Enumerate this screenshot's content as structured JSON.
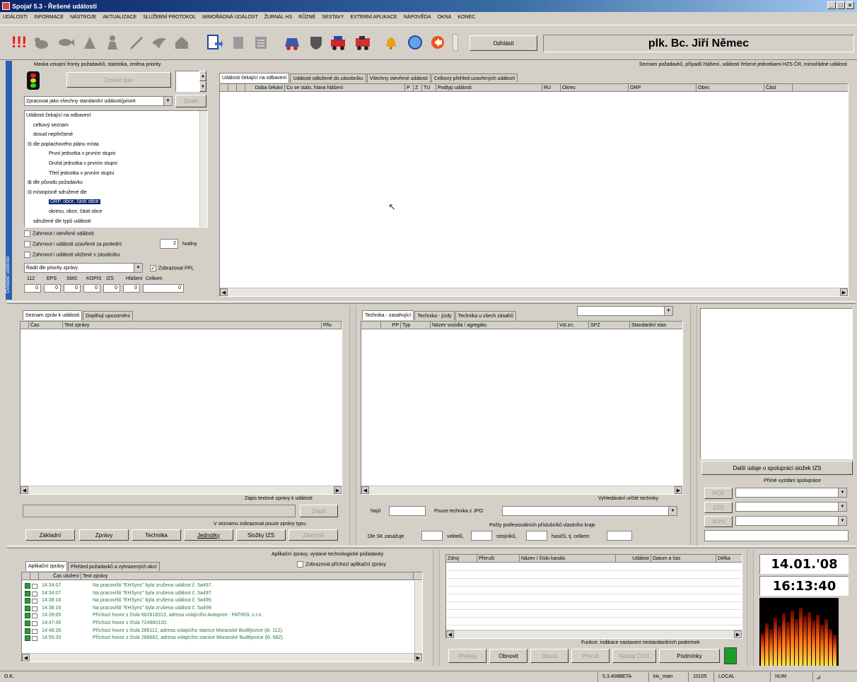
{
  "window": {
    "title": "Spojař 5.3 - Řešené události"
  },
  "menu": [
    "UDÁLOSTI",
    "INFORMACE",
    "NÁSTROJE",
    "AKTUALIZACE",
    "SLUŽEBNÍ PROTOKOL",
    "MIMOŘÁDNÁ UDÁLOST",
    "ŽURNÁL HS",
    "RŮZNÉ",
    "SESTAVY",
    "EXTERNÍ APLIKACE",
    "NÁPOVĚDA",
    "OKNA",
    "KONEC"
  ],
  "toolbar": {
    "odhlasit_label": "Odhlásit",
    "user_name": "plk. Bc. Jiří Němec"
  },
  "filter_panel": {
    "title": "Maska vstupní fronty požadavků, statistika, změna priority",
    "zmena_button": "Změnit stav",
    "mode_select": "Zpracovat jako všechny standardní události(priorit",
    "zmen_button": "Změň",
    "tree": [
      "Události čekající na odbavení",
      "celkový seznam",
      "dosud nepřečtené",
      "dle poplachového plánu místa",
      "První jednotka v prvním stupni",
      "Druhá jednotka v prvním stupni",
      "Třetí jednotka v prvním stupni",
      "dle původu požadavku",
      "místopisně sdružené dle",
      "ORP, obce, části obce",
      "okresu, obce, části obce",
      "sdružené dle typů událostí"
    ],
    "cb1": "Zahrnout i otevřené události",
    "cb2": "Zahrnout i události uzavřené za poslední",
    "hours_value": "2",
    "hours_label": "hodiny",
    "cb3": "Zahrnout i události uložené v zásobníku",
    "sort_select": "Řadit dle priority zprávy",
    "show_ppl": "Zobrazovat PPL",
    "counters": [
      {
        "label": "112",
        "value": "0"
      },
      {
        "label": "EPS",
        "value": "0"
      },
      {
        "label": "SMS",
        "value": "0"
      },
      {
        "label": "KOPIS",
        "value": "0"
      },
      {
        "label": "IZS",
        "value": "0"
      },
      {
        "label": "Hlášení",
        "value": "0"
      },
      {
        "label": "Celkem",
        "value": "0"
      }
    ],
    "side_label": "Ovladač událostí"
  },
  "events": {
    "caption": "Seznam požadavků, případů hlášení, událostí řešené jednotkami HZS ČR, mimořádné události",
    "tabs": [
      "Události čekající na odbavení",
      "Události odložené do zásobníku",
      "Všechny otevřené události",
      "Celkový přehled uzavřených událostí"
    ],
    "columns": [
      "Doba čekání",
      "Co se stalo, hlava hlášení",
      "P",
      "Z",
      "TU",
      "Podtyp události",
      "RU",
      "Okres",
      "ORP",
      "Obec",
      "Část"
    ]
  },
  "messages": {
    "tabs": [
      "Seznam zpráv k události",
      "Doplňují upozornění"
    ],
    "columns": [
      "Čas",
      "Text zprávy",
      "Přiv"
    ],
    "zapis_label": "Zápis textové zprávy k události",
    "zapis_button": "Zapiš",
    "filter_label": "V seznamu zobrazovat pouze zprávy typu:",
    "filter_buttons": [
      "Základní",
      "Zprávy",
      "Technika",
      "Jednotky",
      "Složky IZS",
      "Závorné"
    ]
  },
  "technika": {
    "tabs": [
      "Technika - zasahující",
      "Technika - jízdy",
      "Technika u všech zásahů"
    ],
    "columns": [
      "PP",
      "Typ",
      "Název vozidla / agregátu",
      "Vol.zn.",
      "SPZ",
      "Standardní stan"
    ],
    "search_label": "Vyhledávání určité techniky",
    "najit_label": "Najít",
    "pouze_label": "Pouze technika z JPO:",
    "pocty_label": "Počty profesionálních příslušníků vlastního kraje",
    "dle_label": "Dle SK zasažuje",
    "velitelu": "velitelů,",
    "strojniku": "strojníků,",
    "hasicu": "hasičů, tj. celkem"
  },
  "right_panel": {
    "dalsi_button": "Další údaje o spolupráci složek IZS",
    "prime_label": "Přímé vyzdání spolupráce",
    "combo_buttons": [
      "PČR",
      "ZZS",
      "JKPV"
    ]
  },
  "app_messages": {
    "caption": "Aplikační zprávy, vyslané technologické požadavky",
    "show_all": "Zobrazovat příchozí aplikační zprávy",
    "tabs": [
      "Aplikační zprávy",
      "Přehled požadavků a vyhrazených akcí"
    ],
    "columns": [
      "Čas uložení",
      "Text zprávy"
    ],
    "rows": [
      {
        "time": "14:34:07",
        "text": "Na pracovišti \"EHSync\" byla zrušena událost č. 5a497."
      },
      {
        "time": "14:34:07",
        "text": "Na pracovišti \"EHSync\" byla zrušena událost č. 5a497."
      },
      {
        "time": "14:38:16",
        "text": "Na pracovišti \"EHSync\" byla zrušena událost č. 5a499."
      },
      {
        "time": "14:38:16",
        "text": "Na pracovišti \"EHSync\" byla zrušena událost č. 5a499."
      },
      {
        "time": "14:39:05",
        "text": "Příchozí hovor z čísla 602818313, adresa volajícího Autoprint - PATROL s.r.o."
      },
      {
        "time": "14:47:45",
        "text": "Příchozí hovor z čísla 724980120."
      },
      {
        "time": "14:48:26",
        "text": "Příchozí hovor z čísla 286112, adresa volajícího stanice Moravské Budějovice (kl. 112)."
      },
      {
        "time": "14:55:33",
        "text": "Příchozí hovor z čísla 286682, adresa volajícího stanice Moravské Budějovice (kl. 682)."
      }
    ]
  },
  "radio": {
    "columns": [
      "Zdroj",
      "Přeruší",
      "Název / číslo kanálu",
      "Událost",
      "Datum a čas",
      "Délka"
    ],
    "funkce_label": "Funkce, indikace nastavení nestandardních podmínek",
    "buttons": [
      "Přehraj",
      "Obnovit",
      "Zkouš",
      "Přeruš",
      "Nahraj CD/1",
      "Podmínky"
    ]
  },
  "clock": {
    "date": "14.01.'08",
    "time": "16:13:40"
  },
  "statusbar": {
    "left": "O.K.",
    "version": "5.3.408BETA",
    "server": "kiv_main",
    "code": "10105",
    "mode": "LOCAL",
    "key": "NUM"
  },
  "colors": {
    "accent_blue": "#0a246a",
    "log_green": "#2b7a3a",
    "status_green": "#1f9a2c",
    "selection": "#0a246a"
  }
}
